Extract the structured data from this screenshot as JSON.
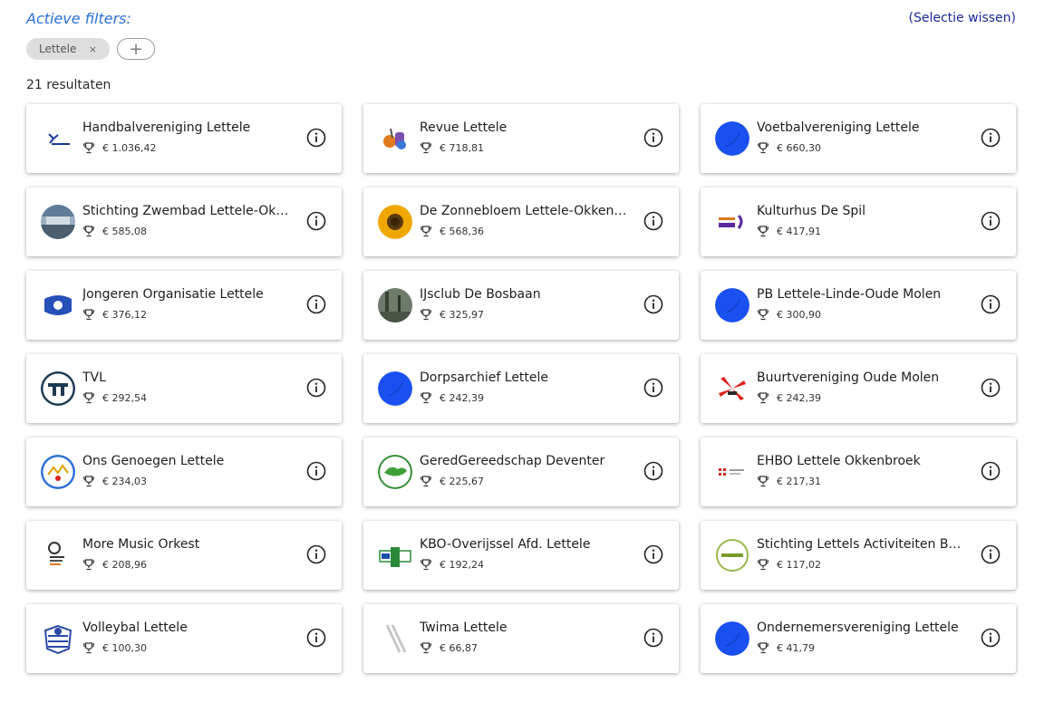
{
  "filters": {
    "title": "Actieve filters:",
    "clear_label": "(Selectie wissen)",
    "chips": [
      {
        "label": "Lettele",
        "close": "×"
      }
    ],
    "add_label": "+"
  },
  "results_label": "21 resultaten",
  "colors": {
    "accent": "#2a6fdb",
    "link": "#1a2a9c",
    "placeholder_logo": "#1a4ff0"
  },
  "cards": [
    {
      "name": "Handbalvereniging Lettele",
      "amount": "€ 1.036,42",
      "logo": "hv-lettele-logo"
    },
    {
      "name": "Revue Lettele",
      "amount": "€ 718,81",
      "logo": "revue-logo"
    },
    {
      "name": "Voetbalvereniging Lettele",
      "amount": "€ 660,30",
      "logo": "blue-placeholder-logo"
    },
    {
      "name": "Stichting Zwembad Lettele-Okkenbroek",
      "amount": "€ 585,08",
      "logo": "zwembad-photo-logo"
    },
    {
      "name": "De Zonnebloem Lettele-Okkenbroek",
      "amount": "€ 568,36",
      "logo": "sunflower-logo"
    },
    {
      "name": "Kulturhus De Spil",
      "amount": "€ 417,91",
      "logo": "de-spil-logo"
    },
    {
      "name": "Jongeren Organisatie Lettele",
      "amount": "€ 376,12",
      "logo": "jol-logo"
    },
    {
      "name": "IJsclub De Bosbaan",
      "amount": "€ 325,97",
      "logo": "forest-photo-logo"
    },
    {
      "name": "PB Lettele-Linde-Oude Molen",
      "amount": "€ 300,90",
      "logo": "blue-placeholder-logo"
    },
    {
      "name": "TVL",
      "amount": "€ 292,54",
      "logo": "tvl-logo"
    },
    {
      "name": "Dorpsarchief Lettele",
      "amount": "€ 242,39",
      "logo": "blue-placeholder-logo"
    },
    {
      "name": "Buurtvereniging Oude Molen",
      "amount": "€ 242,39",
      "logo": "windmill-logo"
    },
    {
      "name": "Ons Genoegen Lettele",
      "amount": "€ 234,03",
      "logo": "ons-genoegen-logo"
    },
    {
      "name": "GeredGereedschap Deventer",
      "amount": "€ 225,67",
      "logo": "bird-logo"
    },
    {
      "name": "EHBO Lettele Okkenbroek",
      "amount": "€ 217,31",
      "logo": "ehbo-logo"
    },
    {
      "name": "More Music Orkest",
      "amount": "€ 208,96",
      "logo": "more-music-logo"
    },
    {
      "name": "KBO-Overijssel Afd. Lettele",
      "amount": "€ 192,24",
      "logo": "kbo-logo"
    },
    {
      "name": "Stichting Lettels Activiteiten Buren",
      "amount": "€ 117,02",
      "logo": "activiteiten-logo"
    },
    {
      "name": "Volleybal Lettele",
      "amount": "€ 100,30",
      "logo": "volleybal-logo"
    },
    {
      "name": "Twima Lettele",
      "amount": "€ 66,87",
      "logo": "twima-logo"
    },
    {
      "name": "Ondernemersvereniging Lettele",
      "amount": "€ 41,79",
      "logo": "blue-placeholder-logo"
    }
  ]
}
